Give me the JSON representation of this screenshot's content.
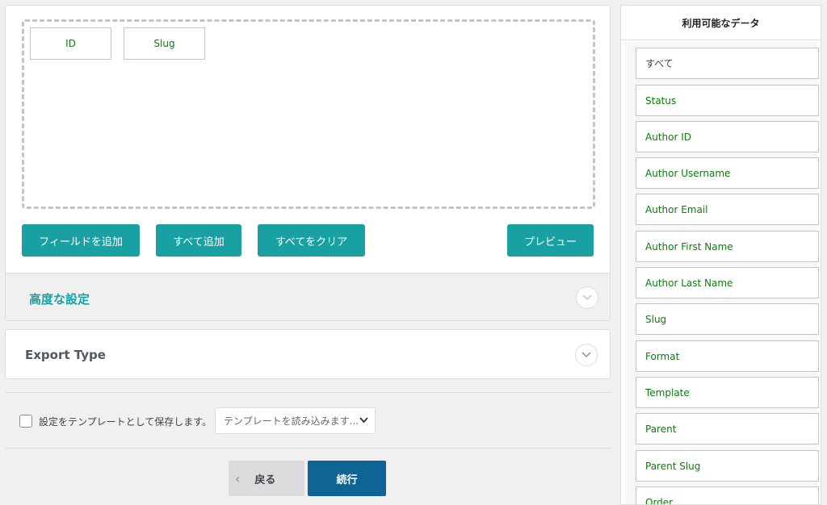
{
  "builder": {
    "chips": [
      "ID",
      "Slug"
    ],
    "buttons": {
      "add_field": "フィールドを追加",
      "add_all": "すべて追加",
      "clear_all": "すべてをクリア",
      "preview": "プレビュー"
    },
    "advanced_title": "高度な設定"
  },
  "export_type": {
    "title": "Export Type"
  },
  "template": {
    "save_label": "設定をテンプレートとして保存します。",
    "load_placeholder": "テンプレートを読み込みます..."
  },
  "nav": {
    "back_label": "戻る",
    "back_icon": "‹",
    "continue_label": "続行"
  },
  "sidebar": {
    "title": "利用可能なデータ",
    "items": [
      "すべて",
      "Status",
      "Author ID",
      "Author Username",
      "Author Email",
      "Author First Name",
      "Author Last Name",
      "Slug",
      "Format",
      "Template",
      "Parent",
      "Parent Slug",
      "Order"
    ]
  },
  "colors": {
    "teal": "#19a0a2",
    "primary_blue": "#0f6496",
    "field_green": "#0a7d0a"
  }
}
